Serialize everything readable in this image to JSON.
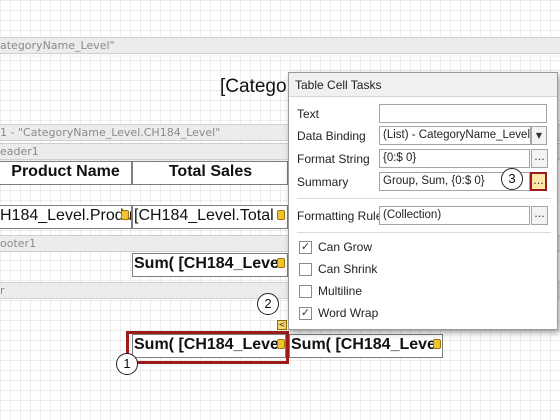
{
  "designer": {
    "top_band_label": "ategoryName_Level\"",
    "title_partial": "[Catego",
    "group_band_label": "1 - \"CategoryName_Level.CH184_Level\"",
    "header_band_label": "eader1",
    "col_product_name": "Product Name",
    "col_total_sales": "Total Sales",
    "detail_product_cell": "H184_Level.Produ",
    "detail_total_cell": "[CH184_Level.Total",
    "footer_band_label": "ooter1",
    "group_footer_sum": "Sum( [CH184_Leve",
    "report_footer_label": "r",
    "selected_sum_cell": "Sum( [CH184_Leve",
    "next_sum_cell": "Sum( [CH184_Leve",
    "smart_tag_glyph": "<"
  },
  "tasks_panel": {
    "title": "Table Cell Tasks",
    "text_label": "Text",
    "text_value": "",
    "data_binding_label": "Data Binding",
    "data_binding_value": "(List) - CategoryName_Level.C",
    "format_string_label": "Format String",
    "format_string_value": "{0:$ 0}",
    "summary_label": "Summary",
    "summary_value": "Group, Sum, {0:$ 0}",
    "formatting_rules_label": "Formatting Rules",
    "formatting_rules_value": "(Collection)",
    "ellipsis": "...",
    "dropdown_glyph": "▼",
    "checkboxes": [
      {
        "label": "Can Grow",
        "checked": true
      },
      {
        "label": "Can Shrink",
        "checked": false
      },
      {
        "label": "Multiline",
        "checked": false
      },
      {
        "label": "Word Wrap",
        "checked": true
      }
    ]
  },
  "callouts": {
    "one": "1",
    "two": "2",
    "three": "3"
  },
  "colors": {
    "highlight": "#9b1b1b",
    "smart_tag": "#f1c232"
  }
}
